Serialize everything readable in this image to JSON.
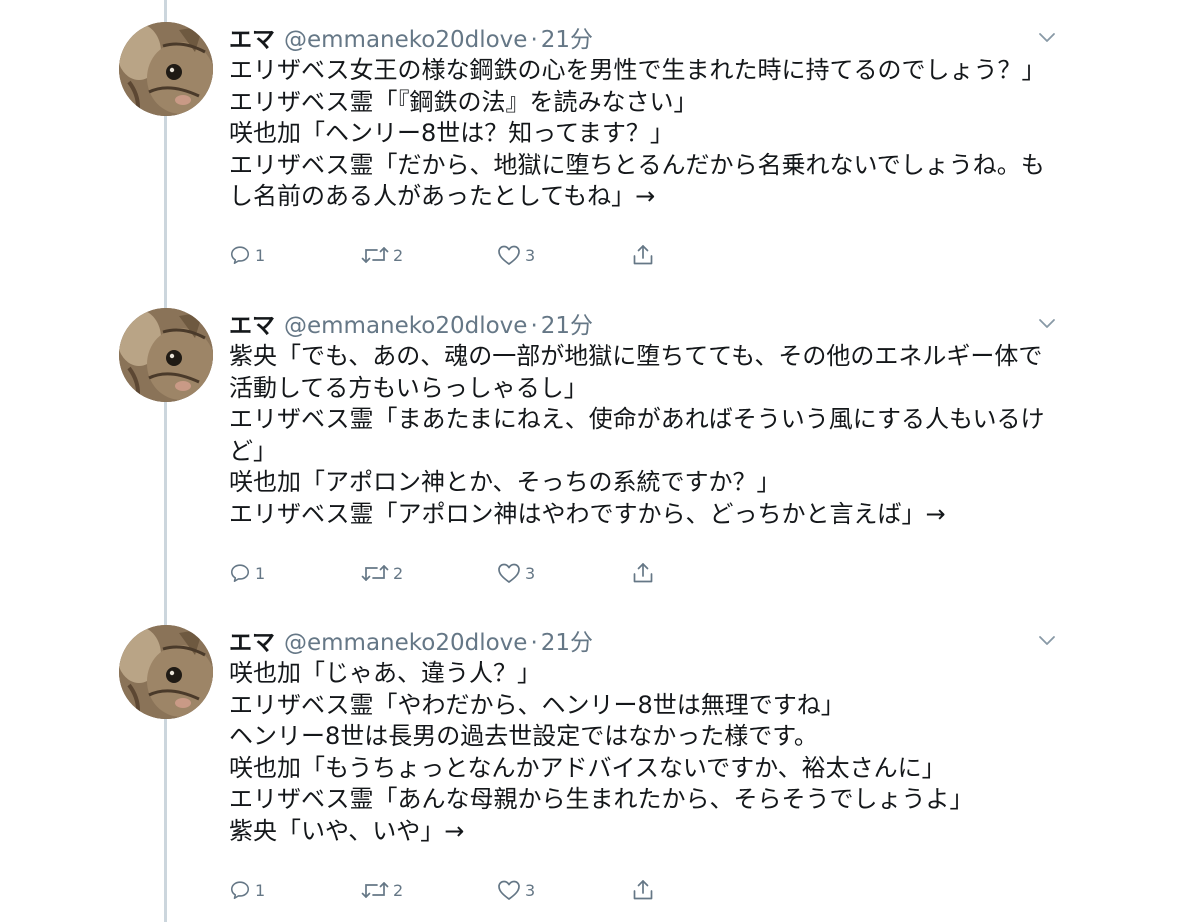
{
  "author": {
    "name": "エマ",
    "handle": "@emmaneko20dlove",
    "time_separator": "·",
    "time": "21分"
  },
  "icons": {
    "reply": "reply-icon",
    "retweet": "retweet-icon",
    "like": "heart-icon",
    "share": "share-icon",
    "more": "chevron-down-icon"
  },
  "colors": {
    "text": "#14171a",
    "muted": "#657786",
    "thread_line": "#ccd6dd"
  },
  "tweets": [
    {
      "lines": [
        "エリザベス女王の様な鋼鉄の心を男性で生まれた時に持てるのでしょう？」",
        "エリザベス霊「『鋼鉄の法』を読みなさい」",
        "咲也加「ヘンリー8世は？知ってます？」",
        "エリザベス霊「だから、地獄に堕ちとるんだから名乗れないでしょうね。も",
        "し名前のある人があったとしてもね」→"
      ],
      "replies": "1",
      "retweets": "2",
      "likes": "3"
    },
    {
      "lines": [
        "紫央「でも、あの、魂の一部が地獄に堕ちてても、その他のエネルギー体で",
        "活動してる方もいらっしゃるし」",
        "エリザベス霊「まあたまにねえ、使命があればそういう風にする人もいるけ",
        "ど」",
        "咲也加「アポロン神とか、そっちの系統ですか？」",
        "エリザベス霊「アポロン神はやわですから、どっちかと言えば」→"
      ],
      "replies": "1",
      "retweets": "2",
      "likes": "3"
    },
    {
      "lines": [
        "咲也加「じゃあ、違う人？」",
        "エリザベス霊「やわだから、ヘンリー8世は無理ですね」",
        "ヘンリー8世は長男の過去世設定ではなかった様です。",
        "咲也加「もうちょっとなんかアドバイスないですか、裕太さんに」",
        "エリザベス霊「あんな母親から生まれたから、そらそうでしょうよ」",
        "紫央「いや、いや」→"
      ],
      "replies": "1",
      "retweets": "2",
      "likes": "3"
    }
  ]
}
